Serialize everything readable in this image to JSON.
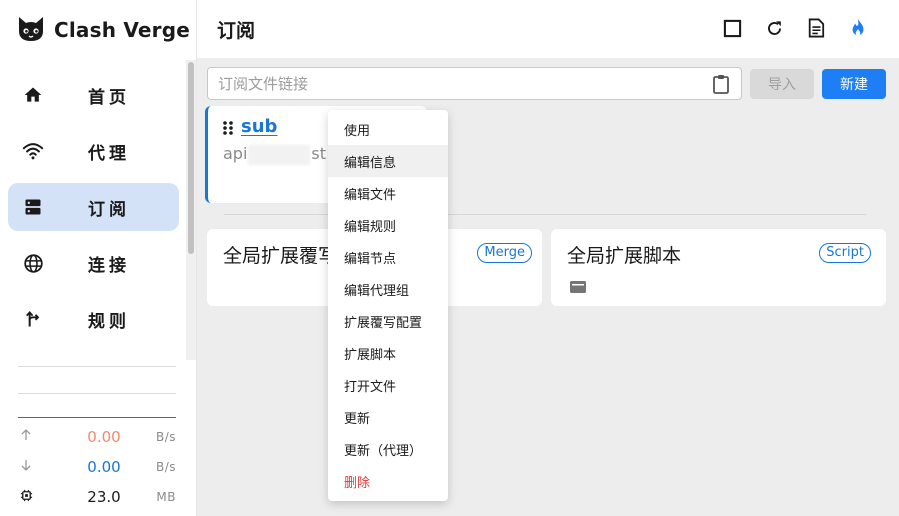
{
  "app": {
    "title": "Clash Verge"
  },
  "sidebar": {
    "items": [
      {
        "label": "首页",
        "icon": "home-icon",
        "active": false
      },
      {
        "label": "代理",
        "icon": "wifi-icon",
        "active": false
      },
      {
        "label": "订阅",
        "icon": "dns-icon",
        "active": true
      },
      {
        "label": "连接",
        "icon": "globe-icon",
        "active": false
      },
      {
        "label": "规则",
        "icon": "fork-icon",
        "active": false
      }
    ],
    "traffic": {
      "upload": {
        "value": "0.00",
        "unit": "B/s",
        "color": "#f08a6a"
      },
      "download": {
        "value": "0.00",
        "unit": "B/s",
        "color": "#1976d2"
      },
      "memory": {
        "value": "23.0",
        "unit": "MB",
        "color": "#1a1a1a"
      }
    }
  },
  "header": {
    "title": "订阅",
    "icons": [
      "square-icon",
      "refresh-icon",
      "document-icon",
      "flame-icon"
    ]
  },
  "toolbar": {
    "url_placeholder": "订阅文件链接",
    "import_label": "导入",
    "new_label": "新建"
  },
  "profile": {
    "name": "sub",
    "url_prefix": "api",
    "url_suffix": "st"
  },
  "extensions": [
    {
      "title": "全局扩展覆写",
      "badge": "Merge"
    },
    {
      "title": "全局扩展脚本",
      "badge": "Script"
    }
  ],
  "context_menu": {
    "items": [
      "使用",
      "编辑信息",
      "编辑文件",
      "编辑规则",
      "编辑节点",
      "编辑代理组",
      "扩展覆写配置",
      "扩展脚本",
      "打开文件",
      "更新",
      "更新（代理）",
      "删除"
    ]
  },
  "colors": {
    "accent": "#1976d2",
    "active_bg": "#d3e2f7",
    "danger": "#e53935"
  }
}
